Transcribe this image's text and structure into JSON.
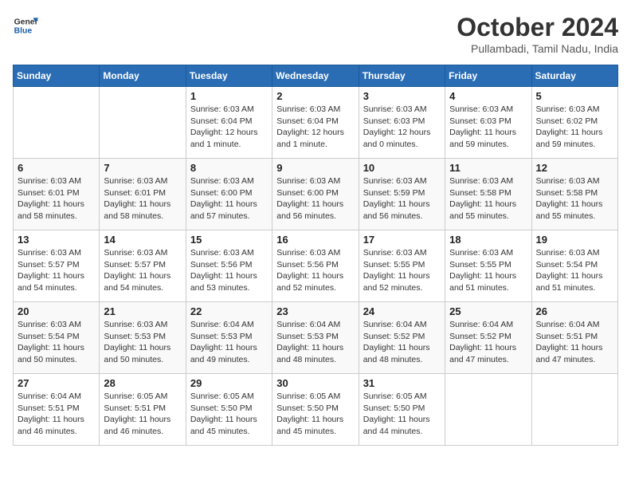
{
  "header": {
    "logo_line1": "General",
    "logo_line2": "Blue",
    "month": "October 2024",
    "location": "Pullambadi, Tamil Nadu, India"
  },
  "days_of_week": [
    "Sunday",
    "Monday",
    "Tuesday",
    "Wednesday",
    "Thursday",
    "Friday",
    "Saturday"
  ],
  "weeks": [
    [
      {
        "day": "",
        "info": ""
      },
      {
        "day": "",
        "info": ""
      },
      {
        "day": "1",
        "info": "Sunrise: 6:03 AM\nSunset: 6:04 PM\nDaylight: 12 hours\nand 1 minute."
      },
      {
        "day": "2",
        "info": "Sunrise: 6:03 AM\nSunset: 6:04 PM\nDaylight: 12 hours\nand 1 minute."
      },
      {
        "day": "3",
        "info": "Sunrise: 6:03 AM\nSunset: 6:03 PM\nDaylight: 12 hours\nand 0 minutes."
      },
      {
        "day": "4",
        "info": "Sunrise: 6:03 AM\nSunset: 6:03 PM\nDaylight: 11 hours\nand 59 minutes."
      },
      {
        "day": "5",
        "info": "Sunrise: 6:03 AM\nSunset: 6:02 PM\nDaylight: 11 hours\nand 59 minutes."
      }
    ],
    [
      {
        "day": "6",
        "info": "Sunrise: 6:03 AM\nSunset: 6:01 PM\nDaylight: 11 hours\nand 58 minutes."
      },
      {
        "day": "7",
        "info": "Sunrise: 6:03 AM\nSunset: 6:01 PM\nDaylight: 11 hours\nand 58 minutes."
      },
      {
        "day": "8",
        "info": "Sunrise: 6:03 AM\nSunset: 6:00 PM\nDaylight: 11 hours\nand 57 minutes."
      },
      {
        "day": "9",
        "info": "Sunrise: 6:03 AM\nSunset: 6:00 PM\nDaylight: 11 hours\nand 56 minutes."
      },
      {
        "day": "10",
        "info": "Sunrise: 6:03 AM\nSunset: 5:59 PM\nDaylight: 11 hours\nand 56 minutes."
      },
      {
        "day": "11",
        "info": "Sunrise: 6:03 AM\nSunset: 5:58 PM\nDaylight: 11 hours\nand 55 minutes."
      },
      {
        "day": "12",
        "info": "Sunrise: 6:03 AM\nSunset: 5:58 PM\nDaylight: 11 hours\nand 55 minutes."
      }
    ],
    [
      {
        "day": "13",
        "info": "Sunrise: 6:03 AM\nSunset: 5:57 PM\nDaylight: 11 hours\nand 54 minutes."
      },
      {
        "day": "14",
        "info": "Sunrise: 6:03 AM\nSunset: 5:57 PM\nDaylight: 11 hours\nand 54 minutes."
      },
      {
        "day": "15",
        "info": "Sunrise: 6:03 AM\nSunset: 5:56 PM\nDaylight: 11 hours\nand 53 minutes."
      },
      {
        "day": "16",
        "info": "Sunrise: 6:03 AM\nSunset: 5:56 PM\nDaylight: 11 hours\nand 52 minutes."
      },
      {
        "day": "17",
        "info": "Sunrise: 6:03 AM\nSunset: 5:55 PM\nDaylight: 11 hours\nand 52 minutes."
      },
      {
        "day": "18",
        "info": "Sunrise: 6:03 AM\nSunset: 5:55 PM\nDaylight: 11 hours\nand 51 minutes."
      },
      {
        "day": "19",
        "info": "Sunrise: 6:03 AM\nSunset: 5:54 PM\nDaylight: 11 hours\nand 51 minutes."
      }
    ],
    [
      {
        "day": "20",
        "info": "Sunrise: 6:03 AM\nSunset: 5:54 PM\nDaylight: 11 hours\nand 50 minutes."
      },
      {
        "day": "21",
        "info": "Sunrise: 6:03 AM\nSunset: 5:53 PM\nDaylight: 11 hours\nand 50 minutes."
      },
      {
        "day": "22",
        "info": "Sunrise: 6:04 AM\nSunset: 5:53 PM\nDaylight: 11 hours\nand 49 minutes."
      },
      {
        "day": "23",
        "info": "Sunrise: 6:04 AM\nSunset: 5:53 PM\nDaylight: 11 hours\nand 48 minutes."
      },
      {
        "day": "24",
        "info": "Sunrise: 6:04 AM\nSunset: 5:52 PM\nDaylight: 11 hours\nand 48 minutes."
      },
      {
        "day": "25",
        "info": "Sunrise: 6:04 AM\nSunset: 5:52 PM\nDaylight: 11 hours\nand 47 minutes."
      },
      {
        "day": "26",
        "info": "Sunrise: 6:04 AM\nSunset: 5:51 PM\nDaylight: 11 hours\nand 47 minutes."
      }
    ],
    [
      {
        "day": "27",
        "info": "Sunrise: 6:04 AM\nSunset: 5:51 PM\nDaylight: 11 hours\nand 46 minutes."
      },
      {
        "day": "28",
        "info": "Sunrise: 6:05 AM\nSunset: 5:51 PM\nDaylight: 11 hours\nand 46 minutes."
      },
      {
        "day": "29",
        "info": "Sunrise: 6:05 AM\nSunset: 5:50 PM\nDaylight: 11 hours\nand 45 minutes."
      },
      {
        "day": "30",
        "info": "Sunrise: 6:05 AM\nSunset: 5:50 PM\nDaylight: 11 hours\nand 45 minutes."
      },
      {
        "day": "31",
        "info": "Sunrise: 6:05 AM\nSunset: 5:50 PM\nDaylight: 11 hours\nand 44 minutes."
      },
      {
        "day": "",
        "info": ""
      },
      {
        "day": "",
        "info": ""
      }
    ]
  ]
}
